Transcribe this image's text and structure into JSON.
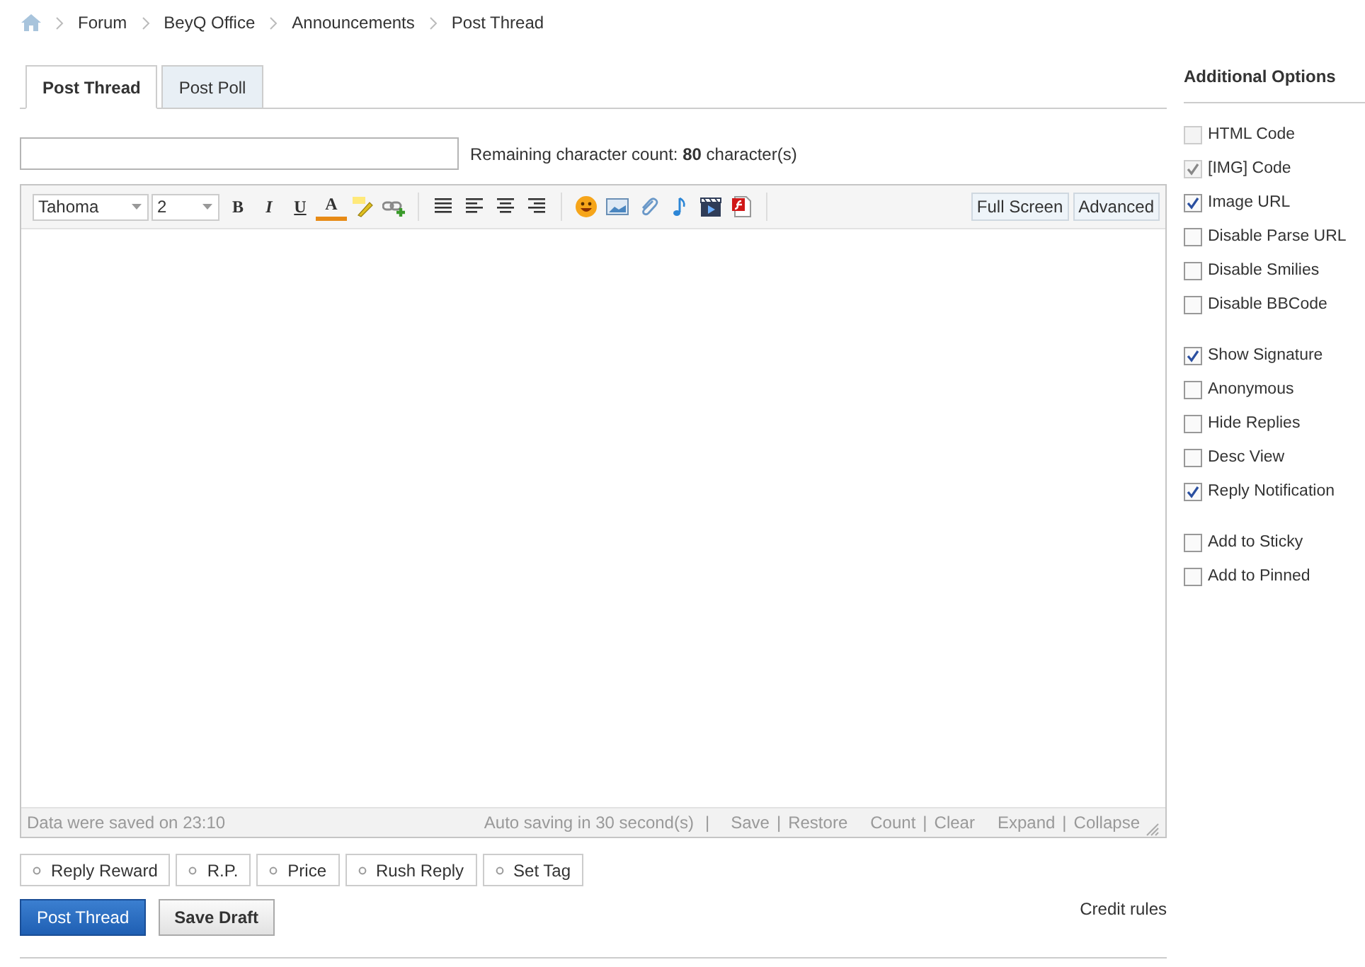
{
  "breadcrumb": [
    "Forum",
    "BeyQ Office",
    "Announcements",
    "Post Thread"
  ],
  "tabs": [
    {
      "label": "Post Thread",
      "selected": true
    },
    {
      "label": "Post Poll",
      "selected": false
    }
  ],
  "char_count": {
    "label": "Remaining character count:",
    "count": "80",
    "unit": "character(s)"
  },
  "editor": {
    "font": "Tahoma",
    "size": "2",
    "format_buttons": [
      "B",
      "I",
      "U",
      "A"
    ],
    "mode_buttons": [
      "Full Screen",
      "Advanced"
    ],
    "status": {
      "saved": "Data were saved on 23:10",
      "auto": "Auto saving in 30 second(s)",
      "separator": "|",
      "link_groups": [
        [
          "Save",
          "Restore"
        ],
        [
          "Count",
          "Clear"
        ],
        [
          "Expand",
          "Collapse"
        ]
      ]
    }
  },
  "extras": [
    "Reply Reward",
    "R.P.",
    "Price",
    "Rush Reply",
    "Set Tag"
  ],
  "actions": {
    "post": "Post Thread",
    "draft": "Save Draft",
    "credit_rules": "Credit rules"
  },
  "sidebar": {
    "title": "Additional Options",
    "groups": [
      [
        {
          "label": "HTML Code",
          "checked": false,
          "disabled": true
        },
        {
          "label": "[IMG] Code",
          "checked": true,
          "disabled": true
        },
        {
          "label": "Image URL",
          "checked": true,
          "disabled": false
        },
        {
          "label": "Disable Parse URL",
          "checked": false,
          "disabled": false
        },
        {
          "label": "Disable Smilies",
          "checked": false,
          "disabled": false
        },
        {
          "label": "Disable BBCode",
          "checked": false,
          "disabled": false
        }
      ],
      [
        {
          "label": "Show Signature",
          "checked": true,
          "disabled": false
        },
        {
          "label": "Anonymous",
          "checked": false,
          "disabled": false
        },
        {
          "label": "Hide Replies",
          "checked": false,
          "disabled": false
        },
        {
          "label": "Desc View",
          "checked": false,
          "disabled": false
        },
        {
          "label": "Reply Notification",
          "checked": true,
          "disabled": false
        }
      ],
      [
        {
          "label": "Add to Sticky",
          "checked": false,
          "disabled": false
        },
        {
          "label": "Add to Pinned",
          "checked": false,
          "disabled": false
        }
      ]
    ]
  }
}
